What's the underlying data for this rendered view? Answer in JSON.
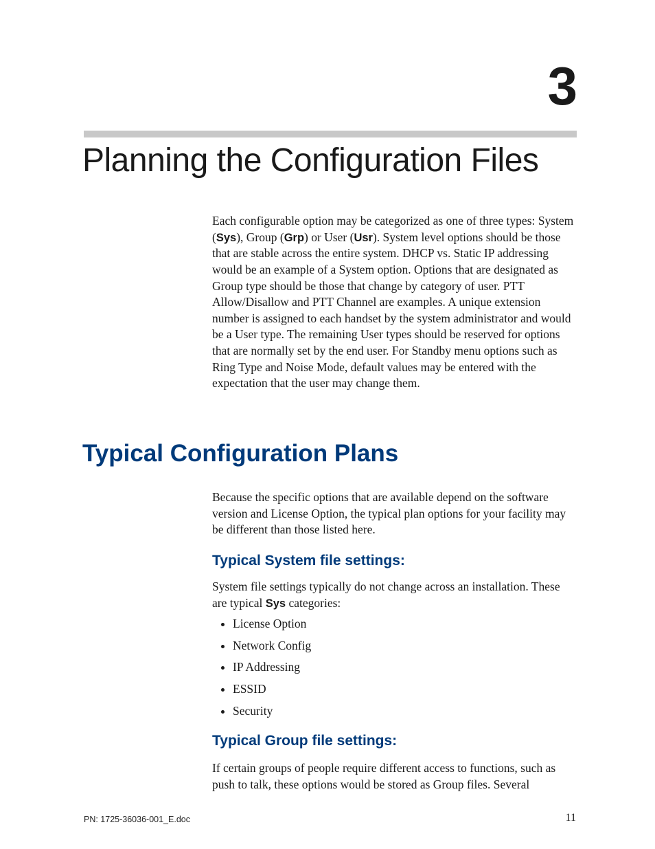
{
  "chapter_number": "3",
  "title": "Planning the Configuration Files",
  "intro": {
    "pre1": "Each configurable option may be categorized as one of three types: System (",
    "sys": "Sys",
    "mid1": "), Group (",
    "grp": "Grp",
    "mid2": ") or User (",
    "usr": "Usr",
    "post": "). System level options should be those that are stable across the entire system. DHCP vs. Static IP addressing would be an example of a System option. Options that are designated as Group type should be those that change by category of user. PTT Allow/Disallow and PTT Channel are examples. A unique extension number is assigned to each handset by the system administrator and would be a User type. The remaining User types should be reserved for options that are normally set by the end user. For Standby menu options such as Ring Type and Noise Mode, default values may be entered with the expectation that the user may change them."
  },
  "h2": "Typical Configuration Plans",
  "para_plans": "Because the specific options that are available depend on the software version and License Option, the typical plan options for your facility may be different than those listed here.",
  "h3_sys": "Typical System file settings:",
  "para_sys_pre": "System file settings typically do not change across an installation. These are typical ",
  "para_sys_bold": "Sys",
  "para_sys_post": " categories:",
  "sys_items": [
    "License Option",
    "Network Config",
    "IP Addressing",
    "ESSID",
    "Security"
  ],
  "h3_grp": "Typical Group file settings:",
  "para_grp": "If certain groups of people require different access to functions, such as push to talk, these options would be stored as Group files. Several",
  "footer_left": "PN: 1725-36036-001_E.doc",
  "footer_right": "11"
}
